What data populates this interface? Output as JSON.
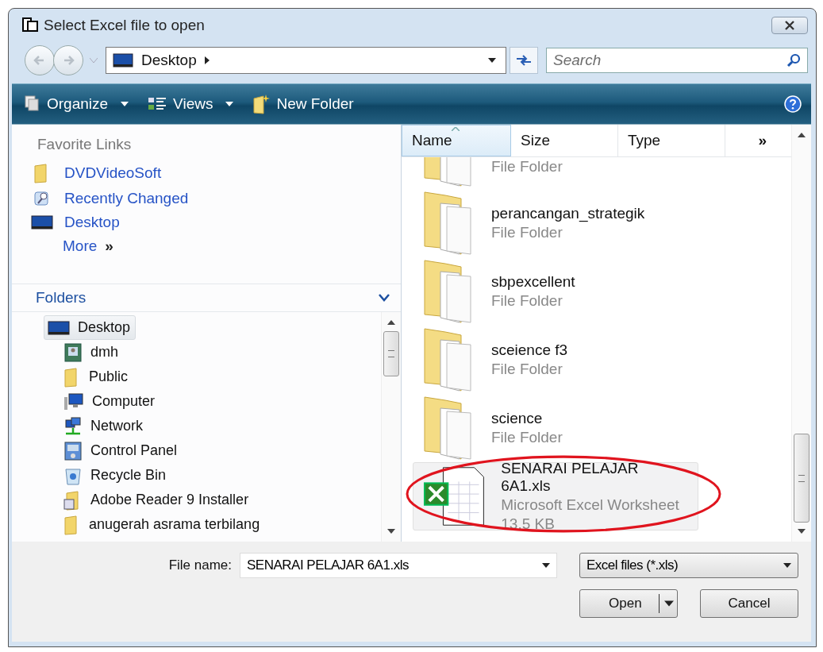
{
  "window": {
    "title": "Select Excel file to open"
  },
  "nav": {
    "location": "Desktop",
    "search": {
      "placeholder": "Search"
    }
  },
  "toolbar": {
    "items": [
      {
        "kind": "organize",
        "label": "Organize"
      },
      {
        "kind": "views",
        "label": "Views"
      },
      {
        "kind": "new-folder",
        "label": "New Folder"
      }
    ]
  },
  "favorite_links": {
    "title": "Favorite Links",
    "items": [
      {
        "kind": "folder",
        "label": "DVDVideoSoft"
      },
      {
        "kind": "recent",
        "label": "Recently Changed"
      },
      {
        "kind": "desktop",
        "label": "Desktop"
      }
    ],
    "more": {
      "label": "More",
      "arrow": "»"
    }
  },
  "folders": {
    "title": "Folders",
    "expanded": true,
    "tree": [
      {
        "label": "Desktop",
        "kind": "desktop",
        "selected": true,
        "children": [
          {
            "label": "dmh",
            "kind": "user",
            "selected": false
          },
          {
            "label": "Public",
            "kind": "folder",
            "selected": false
          },
          {
            "label": "Computer",
            "kind": "computer",
            "selected": false
          },
          {
            "label": "Network",
            "kind": "network",
            "selected": false
          },
          {
            "label": "Control Panel",
            "kind": "control-panel",
            "selected": false
          },
          {
            "label": "Recycle Bin",
            "kind": "recycle-bin",
            "selected": false
          },
          {
            "label": "Adobe Reader 9 Installer",
            "kind": "installer",
            "selected": false
          },
          {
            "label": "anugerah asrama terbilang",
            "kind": "folder",
            "selected": false
          }
        ]
      }
    ]
  },
  "file_list": {
    "columns": [
      {
        "label": "Name",
        "sorted": true
      },
      {
        "label": "Size",
        "sorted": false
      },
      {
        "label": "Type",
        "sorted": false
      },
      {
        "label": "»",
        "sorted": false
      }
    ],
    "items": [
      {
        "kind": "folder",
        "type": "File Folder",
        "selected": false
      },
      {
        "kind": "folder",
        "name": "perancangan_strategik",
        "type": "File Folder",
        "selected": false
      },
      {
        "kind": "folder",
        "name": "sbpexcellent",
        "type": "File Folder",
        "selected": false
      },
      {
        "kind": "folder",
        "name": "sceience f3",
        "type": "File Folder",
        "selected": false
      },
      {
        "kind": "folder",
        "name": "science",
        "type": "File Folder",
        "selected": false
      },
      {
        "kind": "excel",
        "name": "SENARAI PELAJAR 6A1.xls",
        "type": "Microsoft Excel Worksheet",
        "size": "13.5 KB",
        "selected": true
      }
    ]
  },
  "bottom": {
    "file_name_label": "File name:",
    "file_name": "SENARAI PELAJAR 6A1.xls",
    "file_type": "Excel files (*.xls)",
    "buttons": [
      {
        "kind": "split",
        "label": "Open"
      },
      {
        "kind": "plain",
        "label": "Cancel"
      }
    ]
  }
}
